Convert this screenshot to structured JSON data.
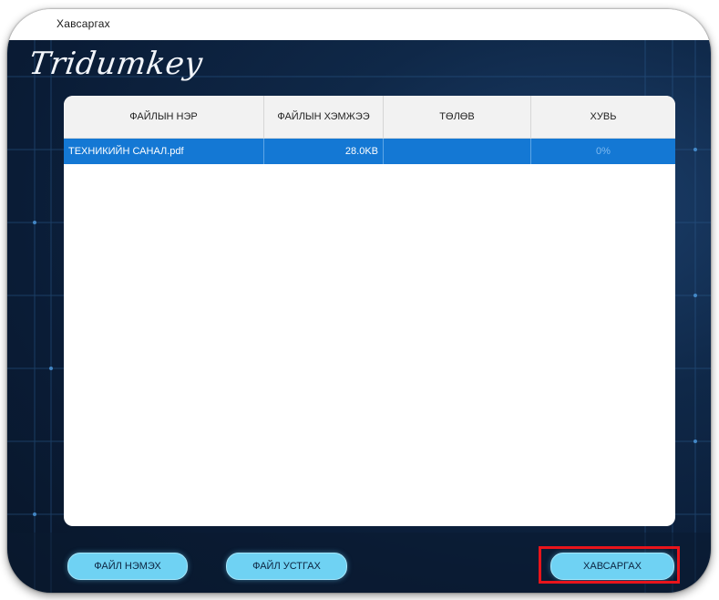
{
  "window": {
    "title": "Хавсаргах"
  },
  "app": {
    "logo_text": "Tridumkey"
  },
  "table": {
    "columns": [
      "ФАЙЛЫН НЭР",
      "ФАЙЛЫН ХЭМЖЭЭ",
      "ТӨЛӨВ",
      "ХУВЬ"
    ],
    "rows": [
      {
        "name": "ТЕХНИКИЙН САНАЛ.pdf",
        "size": "28.0KB",
        "status": "",
        "percent": "0%",
        "selected": true
      }
    ]
  },
  "buttons": {
    "add_file": "ФАЙЛ НЭМЭХ",
    "delete_file": "ФАЙЛ УСТГАХ",
    "attach": "ХАВСАРГАХ"
  },
  "colors": {
    "background": "#0f2848",
    "selected_row": "#1478d4",
    "button": "#6fd2f3",
    "highlight": "#e8141b"
  }
}
